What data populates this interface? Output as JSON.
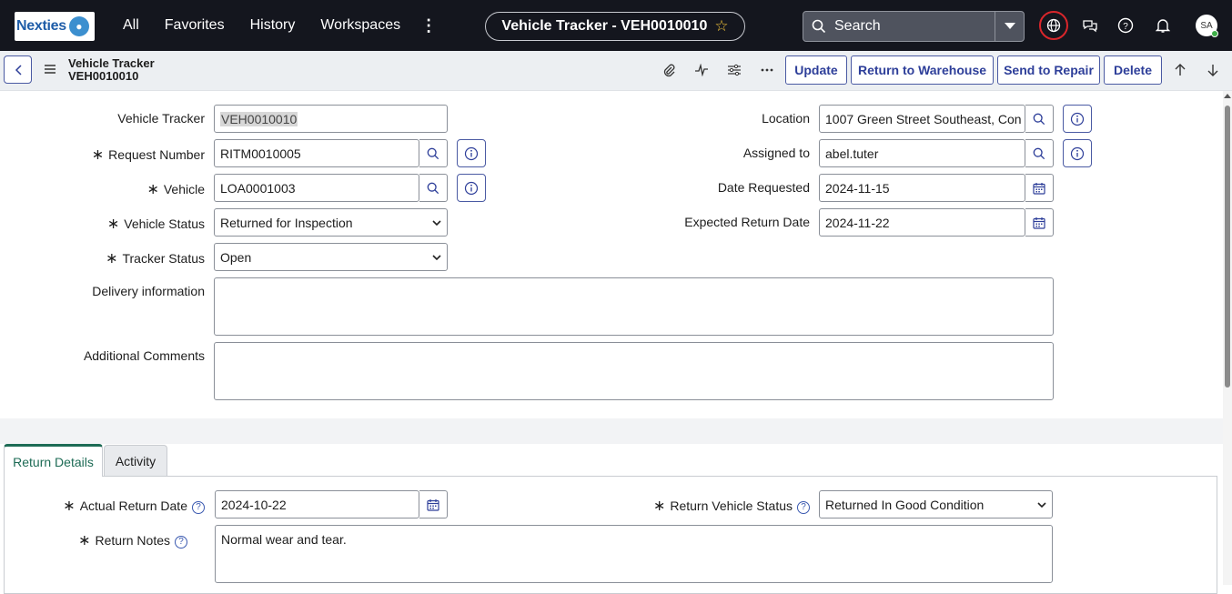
{
  "brand": {
    "logo_text": "Nexties"
  },
  "topnav": {
    "links": [
      "All",
      "Favorites",
      "History",
      "Workspaces"
    ],
    "record_pill": "Vehicle Tracker - VEH0010010",
    "search_placeholder": "Search",
    "avatar_initials": "SA"
  },
  "form_header": {
    "table_name": "Vehicle Tracker",
    "record_number": "VEH0010010",
    "buttons": [
      "Update",
      "Return to Warehouse",
      "Send to Repair",
      "Delete"
    ]
  },
  "fields": {
    "vehicle_tracker": {
      "label": "Vehicle Tracker",
      "value": "VEH0010010"
    },
    "request_number": {
      "label": "Request Number",
      "value": "RITM0010005"
    },
    "vehicle": {
      "label": "Vehicle",
      "value": "LOA0001003"
    },
    "vehicle_status": {
      "label": "Vehicle Status",
      "value": "Returned for Inspection"
    },
    "tracker_status": {
      "label": "Tracker Status",
      "value": "Open"
    },
    "delivery_information": {
      "label": "Delivery information",
      "value": ""
    },
    "additional_comments": {
      "label": "Additional Comments",
      "value": ""
    },
    "location": {
      "label": "Location",
      "value": "1007 Green Street Southeast, Con"
    },
    "assigned_to": {
      "label": "Assigned to",
      "value": "abel.tuter"
    },
    "date_requested": {
      "label": "Date Requested",
      "value": "2024-11-15"
    },
    "expected_return_date": {
      "label": "Expected Return Date",
      "value": "2024-11-22"
    }
  },
  "tabs": [
    "Return Details",
    "Activity"
  ],
  "return_details": {
    "actual_return_date": {
      "label": "Actual Return Date",
      "value": "2024-10-22"
    },
    "return_vehicle_status": {
      "label": "Return Vehicle Status",
      "value": "Returned In Good Condition"
    },
    "return_notes": {
      "label": "Return Notes",
      "value": "Normal wear and tear."
    }
  },
  "colors": {
    "nav_bg": "#14161e",
    "accent": "#2d3e99",
    "tab_active": "#1d6b55",
    "alert_ring": "#d9262b"
  }
}
